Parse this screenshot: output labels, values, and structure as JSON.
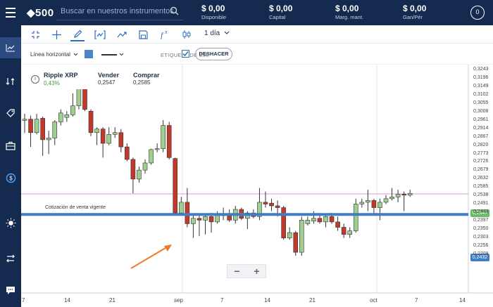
{
  "app": {
    "logo": "◆500"
  },
  "search": {
    "placeholder": "Buscar en nuestros instrumentos"
  },
  "stats": [
    {
      "value": "$ 0,00",
      "label": "Disponible"
    },
    {
      "value": "$ 0,00",
      "label": "Capital"
    },
    {
      "value": "$ 0,00",
      "label": "Marg. mant."
    },
    {
      "value": "$ 0,00",
      "label": "Gan/Pér"
    }
  ],
  "user": {
    "badge": "0"
  },
  "toolbar": {
    "timeframe": "1 día"
  },
  "drawing": {
    "tool_label": "Línea horizontal",
    "color": "#4a86c5",
    "axis_label": "ETIQUETA DE EJE",
    "undo_label": "DESHACER"
  },
  "instrument": {
    "name": "Ripple XRP",
    "change": "0,43%",
    "sell_label": "Vender",
    "sell_price": "0,2547",
    "buy_label": "Comprar",
    "buy_price": "0,2585"
  },
  "chart_data": {
    "type": "candlestick",
    "y_ticks": [
      "0,3243",
      "0,3196",
      "0,3149",
      "0,3102",
      "0,3055",
      "0,3008",
      "0,2961",
      "0,2914",
      "0,2867",
      "0,2820",
      "0,2773",
      "0,2726",
      "0,2679",
      "0,2632",
      "0,2585",
      "0,2538",
      "0,2491",
      "0,2444",
      "0,2397",
      "0,2350",
      "0,2303",
      "0,2256",
      "0,2209"
    ],
    "x_ticks": [
      "7",
      "14",
      "21",
      "sep",
      "7",
      "14",
      "21",
      "oct",
      "7",
      "14"
    ],
    "ylim": [
      0.2175,
      0.3265
    ],
    "sell_quote": {
      "label": "Cotización de venta vigente",
      "value": "0,2547",
      "color": "#d99be0"
    },
    "horizontal_line": {
      "value": "0,2432",
      "color": "#3f7ec4"
    },
    "candles": [
      {
        "o": 0.2958,
        "h": 0.2995,
        "l": 0.2888,
        "c": 0.2965
      },
      {
        "o": 0.2965,
        "h": 0.2985,
        "l": 0.281,
        "c": 0.289
      },
      {
        "o": 0.289,
        "h": 0.2995,
        "l": 0.288,
        "c": 0.2965
      },
      {
        "o": 0.297,
        "h": 0.298,
        "l": 0.276,
        "c": 0.285
      },
      {
        "o": 0.285,
        "h": 0.29,
        "l": 0.277,
        "c": 0.286
      },
      {
        "o": 0.286,
        "h": 0.296,
        "l": 0.282,
        "c": 0.295
      },
      {
        "o": 0.295,
        "h": 0.302,
        "l": 0.293,
        "c": 0.3
      },
      {
        "o": 0.2975,
        "h": 0.301,
        "l": 0.295,
        "c": 0.299
      },
      {
        "o": 0.299,
        "h": 0.311,
        "l": 0.298,
        "c": 0.304
      },
      {
        "o": 0.304,
        "h": 0.315,
        "l": 0.302,
        "c": 0.314
      },
      {
        "o": 0.314,
        "h": 0.318,
        "l": 0.301,
        "c": 0.302
      },
      {
        "o": 0.301,
        "h": 0.302,
        "l": 0.287,
        "c": 0.289
      },
      {
        "o": 0.289,
        "h": 0.292,
        "l": 0.282,
        "c": 0.291
      },
      {
        "o": 0.291,
        "h": 0.292,
        "l": 0.275,
        "c": 0.283
      },
      {
        "o": 0.283,
        "h": 0.292,
        "l": 0.282,
        "c": 0.288
      },
      {
        "o": 0.288,
        "h": 0.292,
        "l": 0.286,
        "c": 0.289
      },
      {
        "o": 0.289,
        "h": 0.291,
        "l": 0.278,
        "c": 0.281
      },
      {
        "o": 0.281,
        "h": 0.283,
        "l": 0.273,
        "c": 0.274
      },
      {
        "o": 0.274,
        "h": 0.275,
        "l": 0.255,
        "c": 0.263
      },
      {
        "o": 0.263,
        "h": 0.27,
        "l": 0.261,
        "c": 0.268
      },
      {
        "o": 0.268,
        "h": 0.274,
        "l": 0.266,
        "c": 0.272
      },
      {
        "o": 0.272,
        "h": 0.28,
        "l": 0.271,
        "c": 0.2795
      },
      {
        "o": 0.2795,
        "h": 0.283,
        "l": 0.278,
        "c": 0.28
      },
      {
        "o": 0.28,
        "h": 0.296,
        "l": 0.278,
        "c": 0.293
      },
      {
        "o": 0.293,
        "h": 0.295,
        "l": 0.274,
        "c": 0.275
      },
      {
        "o": 0.2745,
        "h": 0.275,
        "l": 0.243,
        "c": 0.244
      },
      {
        "o": 0.244,
        "h": 0.253,
        "l": 0.243,
        "c": 0.25
      },
      {
        "o": 0.25,
        "h": 0.258,
        "l": 0.236,
        "c": 0.238
      },
      {
        "o": 0.238,
        "h": 0.243,
        "l": 0.23,
        "c": 0.241
      },
      {
        "o": 0.241,
        "h": 0.243,
        "l": 0.231,
        "c": 0.24
      },
      {
        "o": 0.24,
        "h": 0.243,
        "l": 0.232,
        "c": 0.242
      },
      {
        "o": 0.242,
        "h": 0.244,
        "l": 0.233,
        "c": 0.239
      },
      {
        "o": 0.239,
        "h": 0.245,
        "l": 0.238,
        "c": 0.243
      },
      {
        "o": 0.243,
        "h": 0.247,
        "l": 0.24,
        "c": 0.2425
      },
      {
        "o": 0.2425,
        "h": 0.246,
        "l": 0.239,
        "c": 0.24
      },
      {
        "o": 0.24,
        "h": 0.248,
        "l": 0.238,
        "c": 0.246
      },
      {
        "o": 0.246,
        "h": 0.247,
        "l": 0.24,
        "c": 0.241
      },
      {
        "o": 0.241,
        "h": 0.245,
        "l": 0.235,
        "c": 0.244
      },
      {
        "o": 0.244,
        "h": 0.246,
        "l": 0.241,
        "c": 0.242
      },
      {
        "o": 0.242,
        "h": 0.258,
        "l": 0.24,
        "c": 0.25
      },
      {
        "o": 0.25,
        "h": 0.256,
        "l": 0.247,
        "c": 0.249
      },
      {
        "o": 0.2495,
        "h": 0.252,
        "l": 0.245,
        "c": 0.248
      },
      {
        "o": 0.248,
        "h": 0.251,
        "l": 0.242,
        "c": 0.247
      },
      {
        "o": 0.247,
        "h": 0.248,
        "l": 0.229,
        "c": 0.23
      },
      {
        "o": 0.23,
        "h": 0.236,
        "l": 0.229,
        "c": 0.233
      },
      {
        "o": 0.233,
        "h": 0.234,
        "l": 0.22,
        "c": 0.222
      },
      {
        "o": 0.222,
        "h": 0.242,
        "l": 0.22,
        "c": 0.24
      },
      {
        "o": 0.238,
        "h": 0.242,
        "l": 0.237,
        "c": 0.24
      },
      {
        "o": 0.2395,
        "h": 0.245,
        "l": 0.238,
        "c": 0.241
      },
      {
        "o": 0.241,
        "h": 0.244,
        "l": 0.238,
        "c": 0.239
      },
      {
        "o": 0.239,
        "h": 0.243,
        "l": 0.236,
        "c": 0.242
      },
      {
        "o": 0.242,
        "h": 0.244,
        "l": 0.238,
        "c": 0.239
      },
      {
        "o": 0.239,
        "h": 0.242,
        "l": 0.234,
        "c": 0.236
      },
      {
        "o": 0.236,
        "h": 0.238,
        "l": 0.23,
        "c": 0.232
      },
      {
        "o": 0.232,
        "h": 0.236,
        "l": 0.23,
        "c": 0.234
      },
      {
        "o": 0.234,
        "h": 0.252,
        "l": 0.233,
        "c": 0.249
      },
      {
        "o": 0.249,
        "h": 0.252,
        "l": 0.247,
        "c": 0.25
      },
      {
        "o": 0.25,
        "h": 0.257,
        "l": 0.245,
        "c": 0.251
      },
      {
        "o": 0.251,
        "h": 0.252,
        "l": 0.243,
        "c": 0.247
      },
      {
        "o": 0.247,
        "h": 0.252,
        "l": 0.24,
        "c": 0.25
      },
      {
        "o": 0.25,
        "h": 0.254,
        "l": 0.249,
        "c": 0.252
      },
      {
        "o": 0.252,
        "h": 0.258,
        "l": 0.251,
        "c": 0.253
      },
      {
        "o": 0.253,
        "h": 0.257,
        "l": 0.25,
        "c": 0.2545
      },
      {
        "o": 0.2545,
        "h": 0.256,
        "l": 0.245,
        "c": 0.254
      },
      {
        "o": 0.254,
        "h": 0.257,
        "l": 0.253,
        "c": 0.255
      }
    ]
  }
}
